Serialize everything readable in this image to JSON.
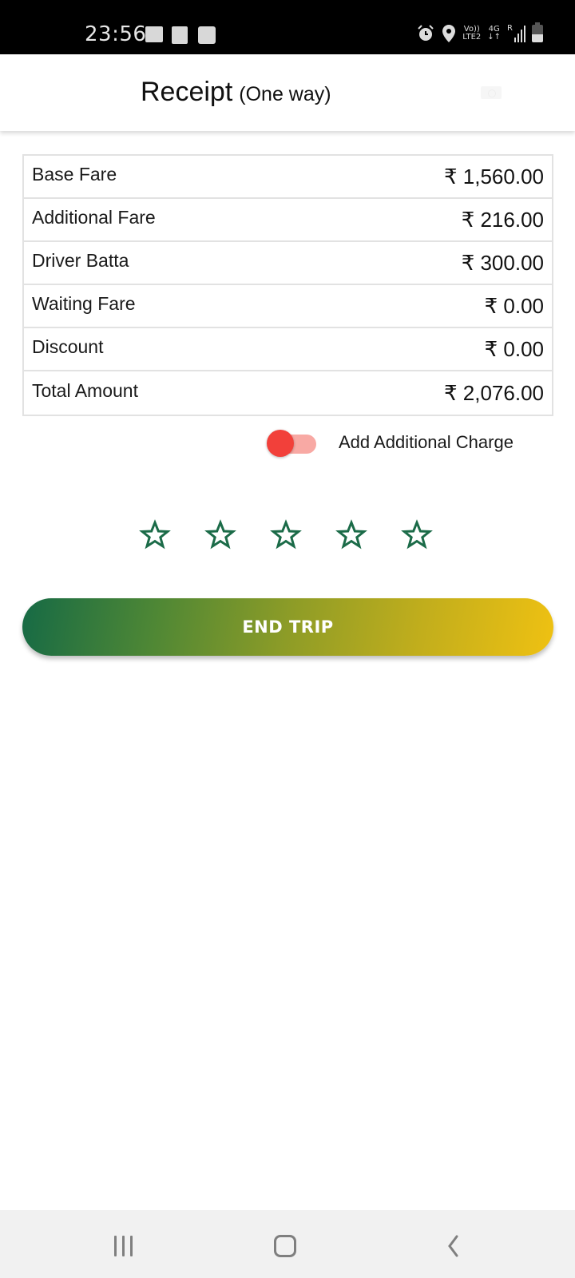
{
  "status_bar": {
    "time": "23:56",
    "left_icons": [
      "gallery-icon",
      "checkbox-icon",
      "wifi-calling-icon"
    ],
    "right_icons": [
      "alarm-icon",
      "location-icon",
      "volte-icon",
      "network-4g-icon",
      "signal-icon",
      "battery-icon"
    ],
    "volte_top": "Vo))",
    "volte_bottom": "LTE2",
    "network_top": "4G",
    "network_bottom": "↓↑",
    "roaming": "R"
  },
  "header": {
    "title": "Receipt",
    "subtitle": "(One way)",
    "right_icon": "cash-icon"
  },
  "fares": [
    {
      "label": "Base Fare",
      "value": "₹ 1,560.00"
    },
    {
      "label": "Additional Fare",
      "value": "₹ 216.00"
    },
    {
      "label": "Driver Batta",
      "value": "₹ 300.00"
    },
    {
      "label": "Waiting Fare",
      "value": "₹ 0.00"
    },
    {
      "label": "Discount",
      "value": "₹ 0.00"
    },
    {
      "label": "Total Amount",
      "value": "₹ 2,076.00"
    }
  ],
  "additional_charge": {
    "label": "Add Additional Charge",
    "enabled": false
  },
  "rating": {
    "max": 5,
    "value": 0,
    "star_color": "#1b6b48"
  },
  "end_trip": {
    "label": "END TRIP",
    "gradient_start": "#166a45",
    "gradient_end": "#efc112"
  },
  "nav_bar": {
    "buttons": [
      "recents-icon",
      "home-icon",
      "back-icon"
    ]
  }
}
